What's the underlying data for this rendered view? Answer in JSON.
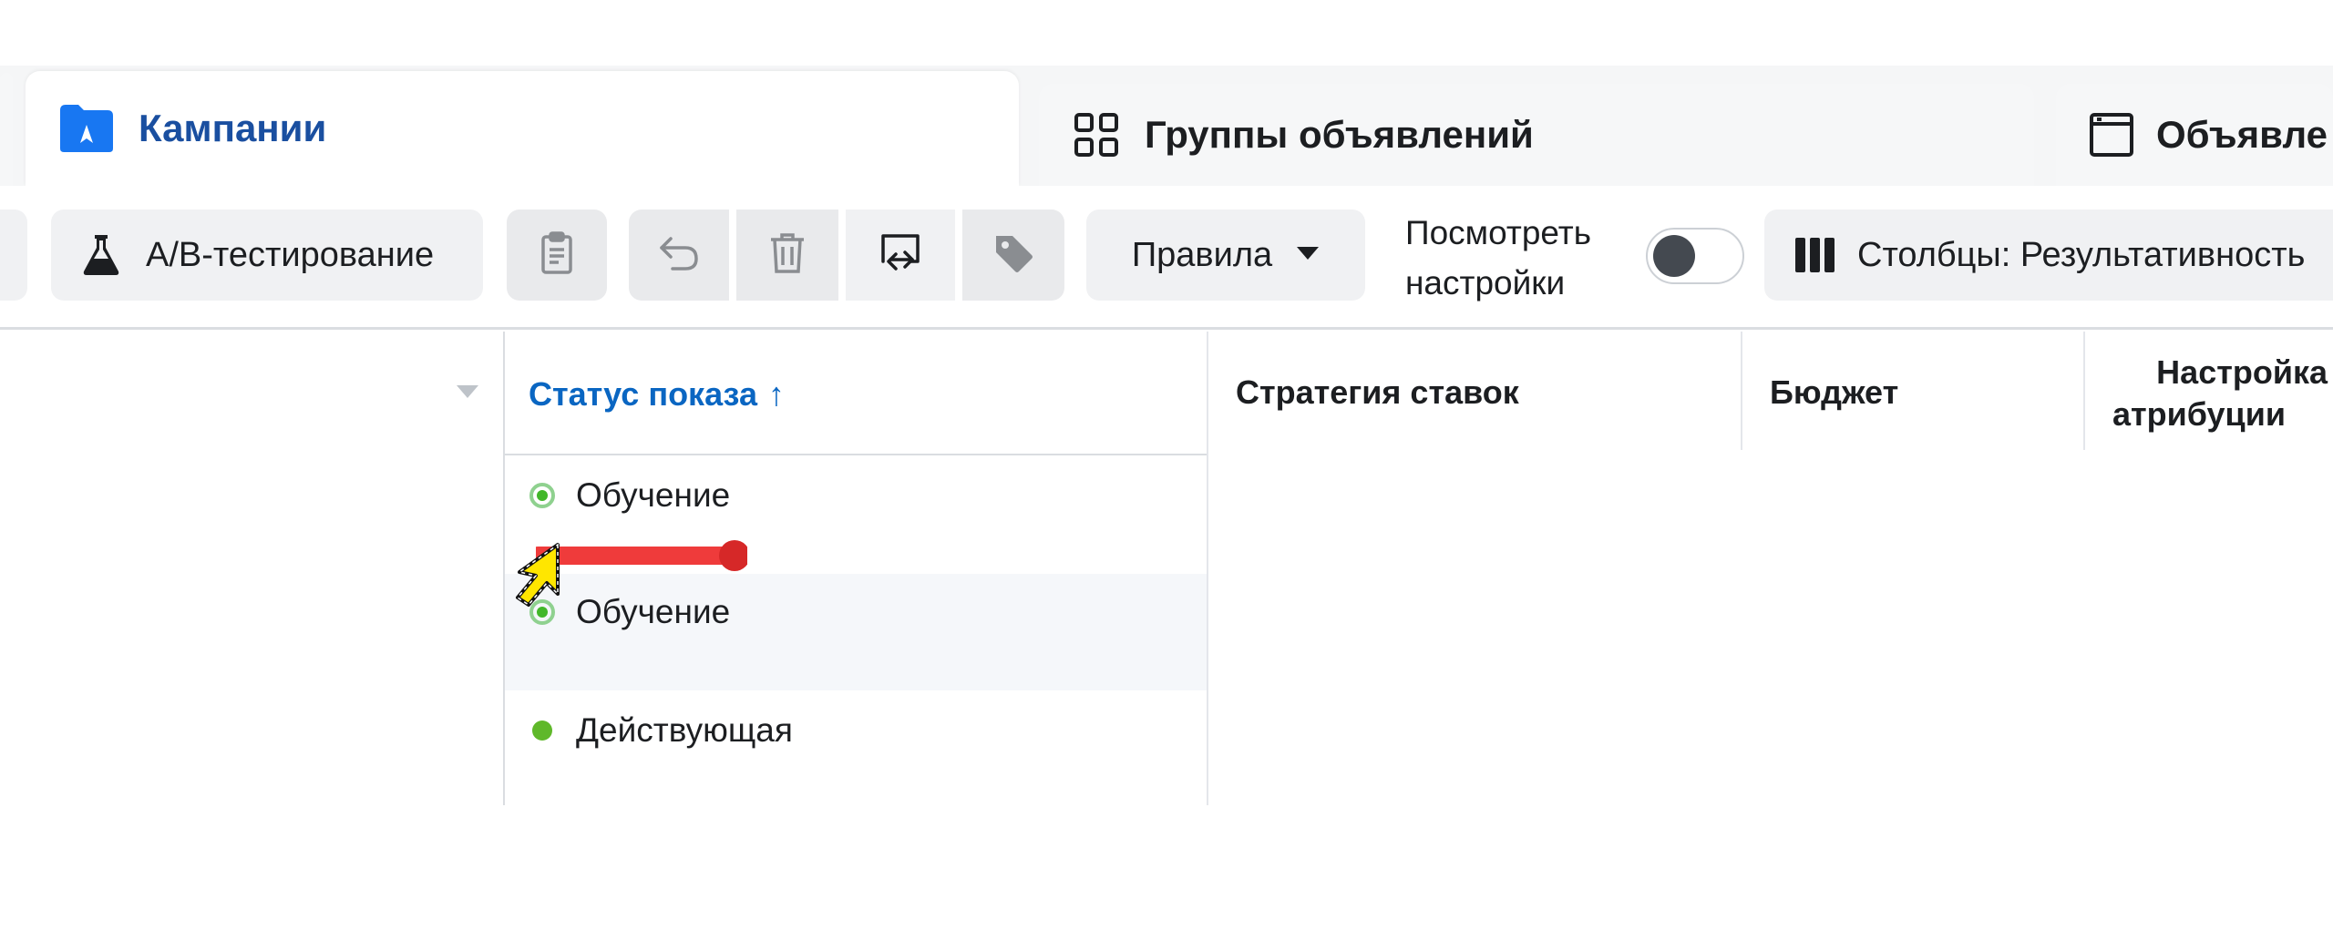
{
  "tabs": [
    {
      "label": "Кампании",
      "icon": "folder-icon",
      "active": true
    },
    {
      "label": "Группы объявлений",
      "icon": "grid-icon",
      "active": false
    },
    {
      "label": "Объявле",
      "icon": "window-icon",
      "active": false
    }
  ],
  "toolbar": {
    "ab_test_label": "A/B-тестирование",
    "rules_label": "Правила",
    "view_settings_label_line1": "Посмотреть",
    "view_settings_label_line2": "настройки",
    "columns_label": "Столбцы: Результативность"
  },
  "table": {
    "headers": {
      "delivery_status": "Статус показа",
      "sort_indicator": "↑",
      "bid_strategy": "Стратегия ставок",
      "budget": "Бюджет",
      "attribution_line1": "Настройка",
      "attribution_line2": "атрибуции"
    },
    "rows": [
      {
        "status": "Обучение",
        "dot": "learning"
      },
      {
        "status": "Обучение",
        "dot": "learning"
      },
      {
        "status": "Действующая",
        "dot": "active"
      }
    ]
  },
  "colors": {
    "accent_blue": "#0a66c2",
    "tab_active_text": "#1a4fa0",
    "status_green": "#5cb85c",
    "annotation_red": "#ef3b3b",
    "cursor_yellow": "#ffe600"
  }
}
